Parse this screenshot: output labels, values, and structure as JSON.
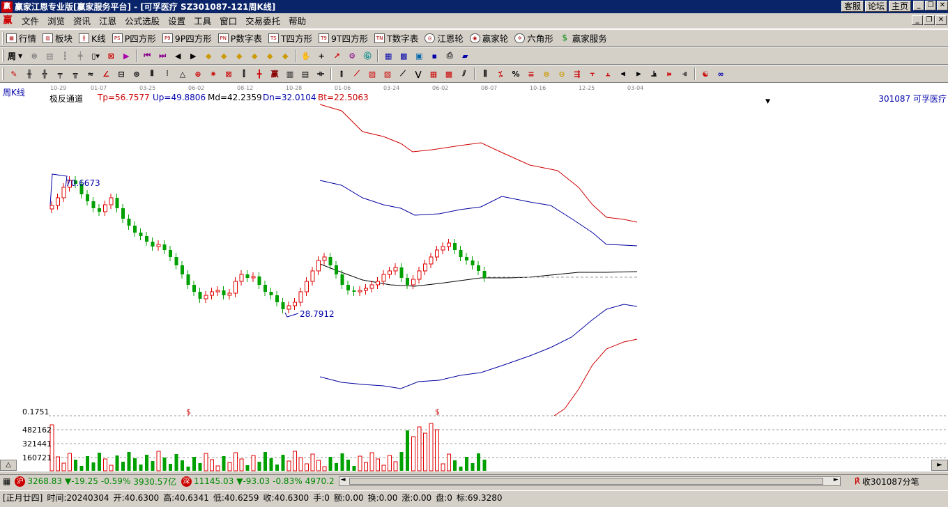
{
  "title": "赢家江恩专业版[赢家服务平台] - [可孚医疗   SZ301087-121周K线]",
  "title_links": [
    "客服",
    "论坛",
    "主页"
  ],
  "menu": [
    "文件",
    "浏览",
    "资讯",
    "江恩",
    "公式选股",
    "设置",
    "工具",
    "窗口",
    "交易委托",
    "帮助"
  ],
  "toolbar1": [
    {
      "label": "行情",
      "icon": "quotes-icon"
    },
    {
      "label": "板块",
      "icon": "sector-icon"
    },
    {
      "label": "K线",
      "icon": "kline-icon"
    },
    {
      "label": "P四方形",
      "icon": "p-square-icon",
      "tag": "PS"
    },
    {
      "label": "9P四方形",
      "icon": "9p-square-icon",
      "tag": "P9"
    },
    {
      "label": "P数字表",
      "icon": "p-number-table-icon",
      "tag": "PN"
    },
    {
      "label": "T四方形",
      "icon": "t-square-icon",
      "tag": "TS"
    },
    {
      "label": "9T四方形",
      "icon": "9t-square-icon",
      "tag": "T9"
    },
    {
      "label": "T数字表",
      "icon": "t-number-table-icon",
      "tag": "TN"
    },
    {
      "label": "江恩轮",
      "icon": "gann-wheel-icon"
    },
    {
      "label": "赢家轮",
      "icon": "winner-wheel-icon"
    },
    {
      "label": "六角形",
      "icon": "hexagon-icon"
    },
    {
      "label": "赢家服务",
      "icon": "dollar-icon"
    }
  ],
  "period": "周",
  "chart": {
    "period_label": "周K线",
    "indicator_name": "极反通道",
    "tp": "Tp=56.7577",
    "up": "Up=49.8806",
    "md": "Md=42.2359",
    "dn": "Dn=32.0104",
    "bt": "Bt=22.5063",
    "stock": "301087  可孚医疗",
    "high_label": "70.6673",
    "low_label": "28.7912",
    "date_ticks": [
      "10-29",
      "01-07",
      "03-25",
      "06-02",
      "08-12",
      "10-28",
      "01-06",
      "03-24",
      "06-02",
      "08-07",
      "10-16",
      "12-25",
      "03-04"
    ],
    "volume_ticks": [
      "0.1751",
      "482162",
      "321441",
      "160721"
    ],
    "marks": [
      "$",
      "$"
    ]
  },
  "chart_data": {
    "type": "candlestick",
    "y_axis": "price",
    "high": 70.6673,
    "low": 28.7912,
    "bands": {
      "tp": 56.7577,
      "up": 49.8806,
      "md": 42.2359,
      "dn": 32.0104,
      "bt": 22.5063
    }
  },
  "status": {
    "sh_tag": "沪",
    "sh_index": "3268.83",
    "sh_change": "▼-19.25",
    "sh_pct": "-0.59%",
    "sh_amount": "3930.57亿",
    "sz_tag": "深",
    "sz_index": "11145.03",
    "sz_change": "▼-93.03",
    "sz_pct": "-0.83%",
    "sz_amount": "4970.2",
    "ticks": "收301087分笔"
  },
  "info": {
    "lunar": "[正月廿四]",
    "time": "时间:20240304",
    "open": "开:40.6300",
    "high": "高:40.6341",
    "low": "低:40.6259",
    "close": "收:40.6300",
    "hand": "手:0",
    "amount": "额:0.00",
    "turnover": "换:0.00",
    "change": "涨:0.00",
    "pan": "盘:0",
    "mark": "标:69.3280"
  },
  "colors": {
    "up": "#e00000",
    "down": "#00a000",
    "band_outer": "#d00000",
    "band_inner": "#0000a0",
    "title_bg": "#0a246a"
  }
}
